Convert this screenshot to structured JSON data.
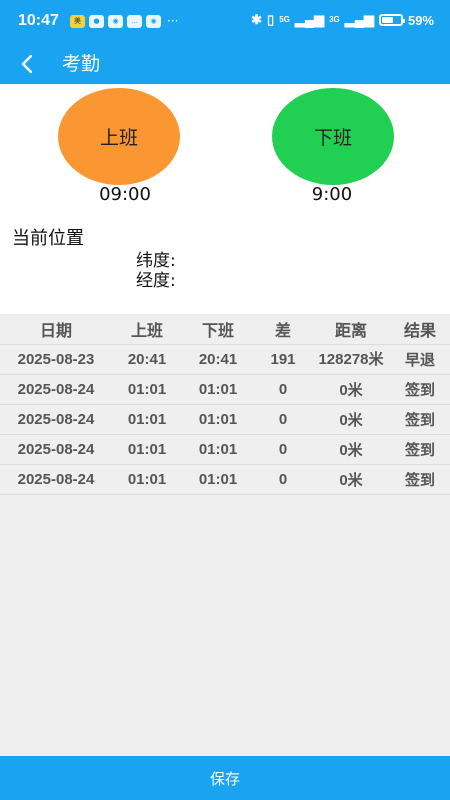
{
  "status_bar": {
    "time": "10:47",
    "app_icons": [
      "meituan-icon",
      "wechat-icon",
      "browser-icon",
      "chat-icon",
      "browser-icon"
    ],
    "more": "···",
    "network": "5G",
    "network2": "3G",
    "battery": "59%",
    "battery_level": 0.59
  },
  "app_bar": {
    "title": "考勤",
    "back_icon": "chevron-left-icon"
  },
  "clock_in": {
    "label": "上班",
    "time": "09:00",
    "color": "#fa9732"
  },
  "clock_out": {
    "label": "下班",
    "time": "9:00",
    "color": "#21d052"
  },
  "location": {
    "title": "当前位置",
    "latitude_label": "纬度:",
    "longitude_label": "经度:"
  },
  "table": {
    "headers": [
      "日期",
      "上班",
      "下班",
      "差",
      "距离",
      "结果"
    ],
    "rows": [
      [
        "2025-08-23",
        "20:41",
        "20:41",
        "191",
        "128278米",
        "早退"
      ],
      [
        "2025-08-24",
        "01:01",
        "01:01",
        "0",
        "0米",
        "签到"
      ],
      [
        "2025-08-24",
        "01:01",
        "01:01",
        "0",
        "0米",
        "签到"
      ],
      [
        "2025-08-24",
        "01:01",
        "01:01",
        "0",
        "0米",
        "签到"
      ],
      [
        "2025-08-24",
        "01:01",
        "01:01",
        "0",
        "0米",
        "签到"
      ]
    ]
  },
  "save_button": {
    "label": "保存"
  },
  "colors": {
    "primary": "#1aa3f0",
    "table_bg": "#efefef"
  }
}
